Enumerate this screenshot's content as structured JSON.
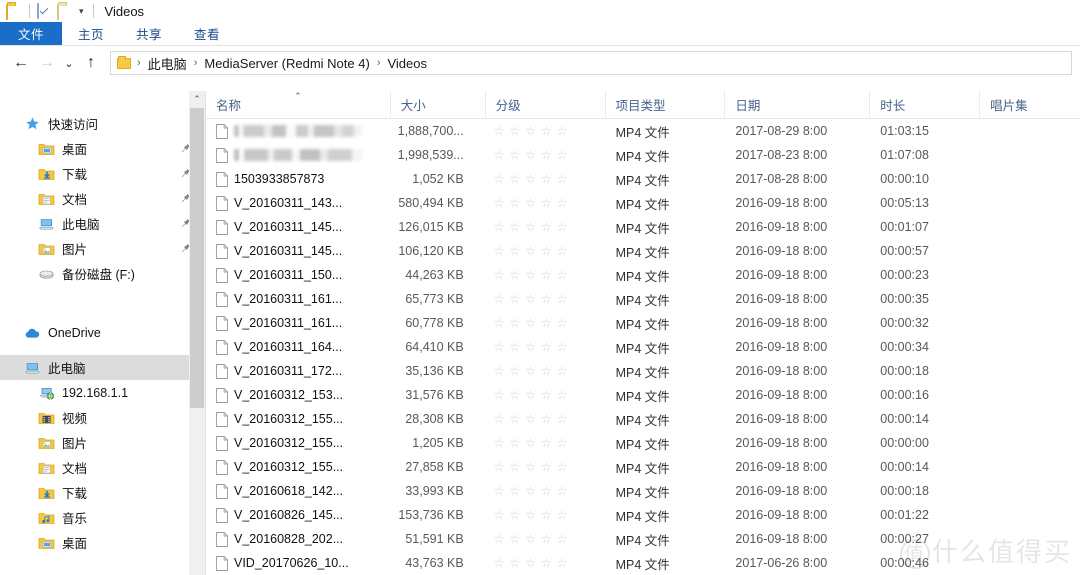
{
  "window": {
    "title": "Videos",
    "quick_access_icons": [
      "folder-icon",
      "properties-icon",
      "new-folder-icon",
      "customize-chevron-icon"
    ]
  },
  "ribbon": {
    "tabs": [
      {
        "label": "文件",
        "active": true
      },
      {
        "label": "主页",
        "active": false
      },
      {
        "label": "共享",
        "active": false
      },
      {
        "label": "查看",
        "active": false
      }
    ]
  },
  "addressbar": {
    "back_icon": "back-arrow-icon",
    "forward_icon": "forward-arrow-icon",
    "history_icon": "recent-locations-chevron-icon",
    "up_icon": "up-arrow-icon",
    "breadcrumbs": [
      "此电脑",
      "MediaServer (Redmi Note 4)",
      "Videos"
    ],
    "separator": "›"
  },
  "sidebar": {
    "groups": [
      {
        "header": {
          "label": "快速访问",
          "icon": "star-pin-icon"
        },
        "items": [
          {
            "label": "桌面",
            "icon": "desktop-folder-icon",
            "pinned": true
          },
          {
            "label": "下载",
            "icon": "downloads-folder-icon",
            "pinned": true
          },
          {
            "label": "文档",
            "icon": "documents-folder-icon",
            "pinned": true
          },
          {
            "label": "此电脑",
            "icon": "this-pc-icon",
            "pinned": true
          },
          {
            "label": "图片",
            "icon": "pictures-folder-icon",
            "pinned": true
          },
          {
            "label": "备份磁盘 (F:)",
            "icon": "hard-disk-icon",
            "pinned": false
          }
        ]
      },
      {
        "header": {
          "label": "OneDrive",
          "icon": "onedrive-cloud-icon"
        },
        "items": []
      },
      {
        "header": {
          "label": "此电脑",
          "icon": "this-pc-icon",
          "selected": true
        },
        "items": [
          {
            "label": "192.168.1.1",
            "icon": "network-computer-icon",
            "pinned": false
          },
          {
            "label": "视频",
            "icon": "videos-folder-icon",
            "pinned": false
          },
          {
            "label": "图片",
            "icon": "pictures-folder-icon",
            "pinned": false
          },
          {
            "label": "文档",
            "icon": "documents-folder-icon",
            "pinned": false
          },
          {
            "label": "下载",
            "icon": "downloads-folder-icon",
            "pinned": false
          },
          {
            "label": "音乐",
            "icon": "music-folder-icon",
            "pinned": false
          },
          {
            "label": "桌面",
            "icon": "desktop-folder-icon",
            "pinned": false
          }
        ]
      }
    ]
  },
  "filelist": {
    "columns": [
      {
        "key": "name",
        "label": "名称",
        "sorted": "asc"
      },
      {
        "key": "size",
        "label": "大小",
        "sorted": ""
      },
      {
        "key": "rating",
        "label": "分级",
        "sorted": ""
      },
      {
        "key": "type",
        "label": "项目类型",
        "sorted": ""
      },
      {
        "key": "date",
        "label": "日期",
        "sorted": ""
      },
      {
        "key": "len",
        "label": "时长",
        "sorted": ""
      },
      {
        "key": "album",
        "label": "唱片集",
        "sorted": ""
      }
    ],
    "rating_stars": 5,
    "rating_filled": 0,
    "rows": [
      {
        "name": "",
        "redacted": true,
        "size": "1,888,700...",
        "type": "MP4 文件",
        "date": "2017-08-29 8:00",
        "len": "01:03:15"
      },
      {
        "name": "",
        "redacted": true,
        "size": "1,998,539...",
        "type": "MP4 文件",
        "date": "2017-08-23 8:00",
        "len": "01:07:08"
      },
      {
        "name": "1503933857873",
        "redacted": false,
        "size": "1,052 KB",
        "type": "MP4 文件",
        "date": "2017-08-28 8:00",
        "len": "00:00:10"
      },
      {
        "name": "V_20160311_143...",
        "redacted": false,
        "size": "580,494 KB",
        "type": "MP4 文件",
        "date": "2016-09-18 8:00",
        "len": "00:05:13"
      },
      {
        "name": "V_20160311_145...",
        "redacted": false,
        "size": "126,015 KB",
        "type": "MP4 文件",
        "date": "2016-09-18 8:00",
        "len": "00:01:07"
      },
      {
        "name": "V_20160311_145...",
        "redacted": false,
        "size": "106,120 KB",
        "type": "MP4 文件",
        "date": "2016-09-18 8:00",
        "len": "00:00:57"
      },
      {
        "name": "V_20160311_150...",
        "redacted": false,
        "size": "44,263 KB",
        "type": "MP4 文件",
        "date": "2016-09-18 8:00",
        "len": "00:00:23"
      },
      {
        "name": "V_20160311_161...",
        "redacted": false,
        "size": "65,773 KB",
        "type": "MP4 文件",
        "date": "2016-09-18 8:00",
        "len": "00:00:35"
      },
      {
        "name": "V_20160311_161...",
        "redacted": false,
        "size": "60,778 KB",
        "type": "MP4 文件",
        "date": "2016-09-18 8:00",
        "len": "00:00:32"
      },
      {
        "name": "V_20160311_164...",
        "redacted": false,
        "size": "64,410 KB",
        "type": "MP4 文件",
        "date": "2016-09-18 8:00",
        "len": "00:00:34"
      },
      {
        "name": "V_20160311_172...",
        "redacted": false,
        "size": "35,136 KB",
        "type": "MP4 文件",
        "date": "2016-09-18 8:00",
        "len": "00:00:18"
      },
      {
        "name": "V_20160312_153...",
        "redacted": false,
        "size": "31,576 KB",
        "type": "MP4 文件",
        "date": "2016-09-18 8:00",
        "len": "00:00:16"
      },
      {
        "name": "V_20160312_155...",
        "redacted": false,
        "size": "28,308 KB",
        "type": "MP4 文件",
        "date": "2016-09-18 8:00",
        "len": "00:00:14"
      },
      {
        "name": "V_20160312_155...",
        "redacted": false,
        "size": "1,205 KB",
        "type": "MP4 文件",
        "date": "2016-09-18 8:00",
        "len": "00:00:00"
      },
      {
        "name": "V_20160312_155...",
        "redacted": false,
        "size": "27,858 KB",
        "type": "MP4 文件",
        "date": "2016-09-18 8:00",
        "len": "00:00:14"
      },
      {
        "name": "V_20160618_142...",
        "redacted": false,
        "size": "33,993 KB",
        "type": "MP4 文件",
        "date": "2016-09-18 8:00",
        "len": "00:00:18"
      },
      {
        "name": "V_20160826_145...",
        "redacted": false,
        "size": "153,736 KB",
        "type": "MP4 文件",
        "date": "2016-09-18 8:00",
        "len": "00:01:22"
      },
      {
        "name": "V_20160828_202...",
        "redacted": false,
        "size": "51,591 KB",
        "type": "MP4 文件",
        "date": "2016-09-18 8:00",
        "len": "00:00:27"
      },
      {
        "name": "VID_20170626_10...",
        "redacted": false,
        "size": "43,763 KB",
        "type": "MP4 文件",
        "date": "2017-06-26 8:00",
        "len": "00:00:46"
      }
    ]
  },
  "watermark": {
    "badge": "值",
    "text": "什么值得买"
  }
}
